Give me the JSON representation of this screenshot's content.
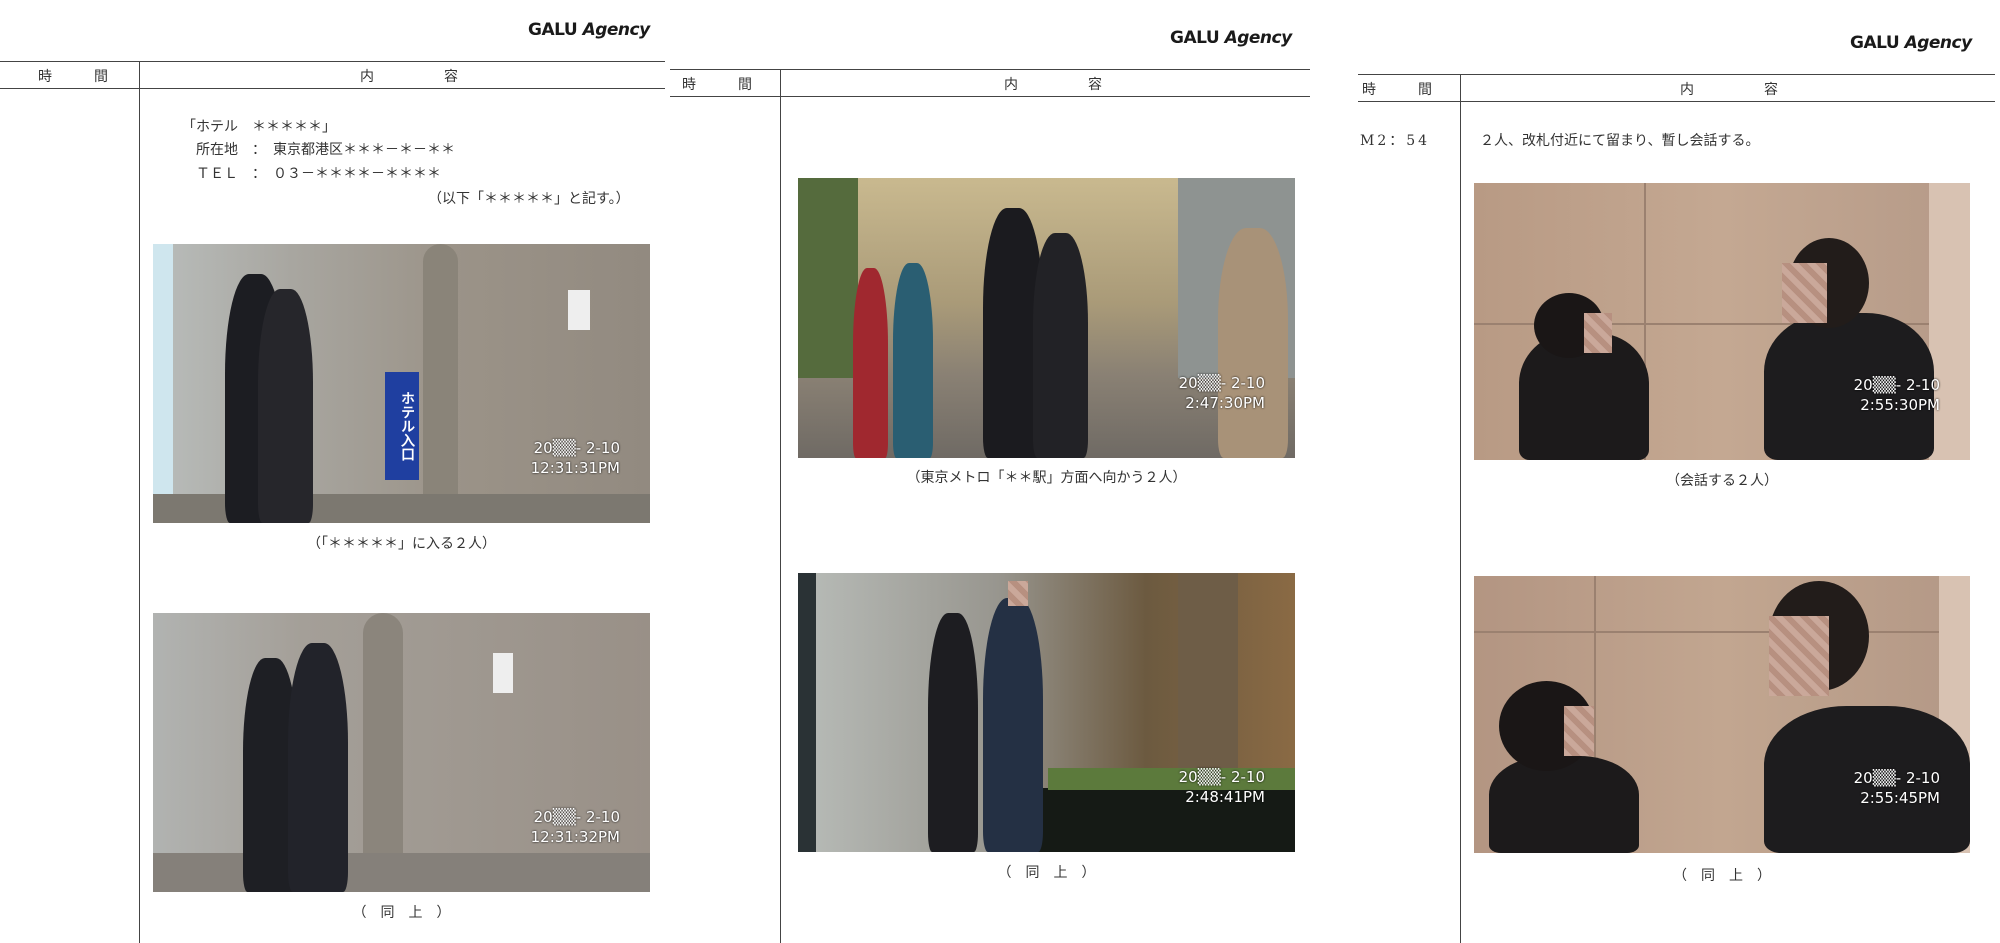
{
  "logo": {
    "brand": "GALU",
    "suffix": "Agency"
  },
  "table_header": {
    "time": "時　間",
    "content": "内　　容"
  },
  "page1": {
    "hotel_name": "「ホテル　＊＊＊＊＊」",
    "address": "所在地　：　東京都港区＊＊＊－＊－＊＊",
    "tel": "ＴＥＬ　：　０３－＊＊＊＊－＊＊＊＊",
    "note": "（以下「＊＊＊＊＊」と記す。）",
    "sign_text": "ホテル入口",
    "photo1": {
      "timestamp": "20▒▒- 2-10\n12:31:31PM",
      "caption": "（「＊＊＊＊＊」に入る２人）"
    },
    "photo2": {
      "timestamp": "20▒▒- 2-10\n12:31:32PM",
      "caption": "（　同　上　）"
    }
  },
  "page2": {
    "photo1": {
      "timestamp": "20▒▒- 2-10\n2:47:30PM",
      "caption": "（東京メトロ「＊＊駅」方面へ向かう２人）"
    },
    "photo2": {
      "timestamp": "20▒▒- 2-10\n2:48:41PM",
      "caption": "（　同　上　）"
    }
  },
  "page3": {
    "time": "M2：54",
    "entry": "２人、改札付近にて留まり、暫し会話する。",
    "photo1": {
      "timestamp": "20▒▒- 2-10\n2:55:30PM",
      "caption": "（会話する２人）"
    },
    "photo2": {
      "timestamp": "20▒▒- 2-10\n2:55:45PM",
      "caption": "（　同　上　）"
    }
  }
}
